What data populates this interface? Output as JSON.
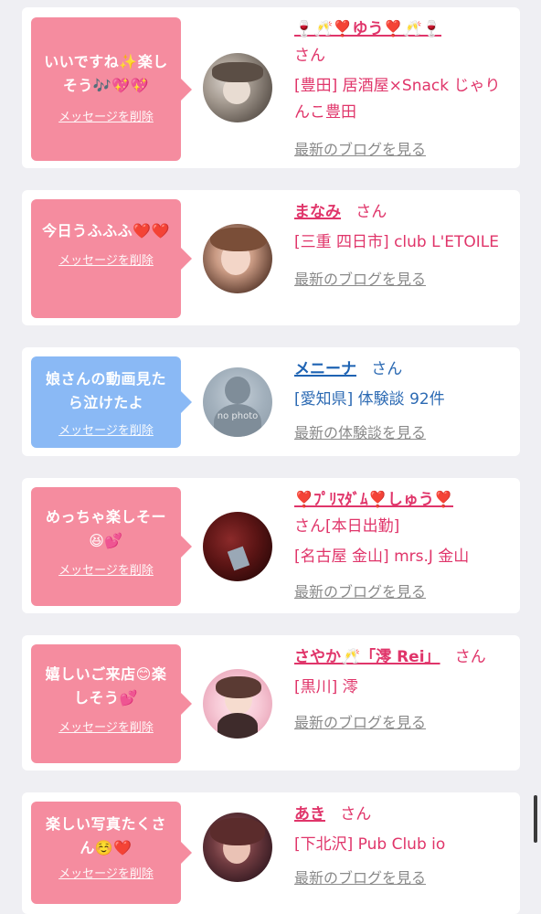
{
  "cards": [
    {
      "message": "いいですね✨楽しそう🎶💖💖",
      "delete": "メッセージを削除",
      "name": "🍷🥂❣️ゆう❣️🥂🍷",
      "san": "さん",
      "shop": "[豊田] 居酒屋×Snack じゃりんこ豊田",
      "link": "最新のブログを見る"
    },
    {
      "message": "今日うふふふ❤️❤️",
      "delete": "メッセージを削除",
      "name": "まなみ",
      "san": "さん",
      "shop": "[三重 四日市] club L'ETOILE",
      "link": "最新のブログを見る"
    },
    {
      "message": "娘さんの動画見たら泣けたよ",
      "delete": "メッセージを削除",
      "name": "メニーナ",
      "san": "さん",
      "shop": "[愛知県] 体験談 92件",
      "link": "最新の体験談を見る",
      "avatar_text": "no photo"
    },
    {
      "message": "めっちゃ楽しそー😆💕",
      "delete": "メッセージを削除",
      "name": "❣️ﾌﾟﾘﾏﾀﾞﾑ❣️しゅう❣️",
      "san": "さん[本日出勤]",
      "shop": "[名古屋 金山] mrs.J 金山",
      "link": "最新のブログを見る"
    },
    {
      "message": "嬉しいご来店😊楽しそう💕",
      "delete": "メッセージを削除",
      "name": "さやか🥂「澪 Rei」",
      "san": "さん",
      "shop": "[黒川] 澪",
      "link": "最新のブログを見る"
    },
    {
      "message": "楽しい写真たくさん☺️❤️",
      "delete": "メッセージを削除",
      "name": "あき",
      "san": "さん",
      "shop": "[下北沢] Pub Club io",
      "link": "最新のブログを見る"
    }
  ],
  "colors": {
    "pink_bubble": "#f58c9f",
    "blue_bubble": "#8ab9f5",
    "pink_text": "#e0356a",
    "blue_text": "#1e63b3",
    "link_gray": "#8a8a8a",
    "background": "#efeff3"
  }
}
